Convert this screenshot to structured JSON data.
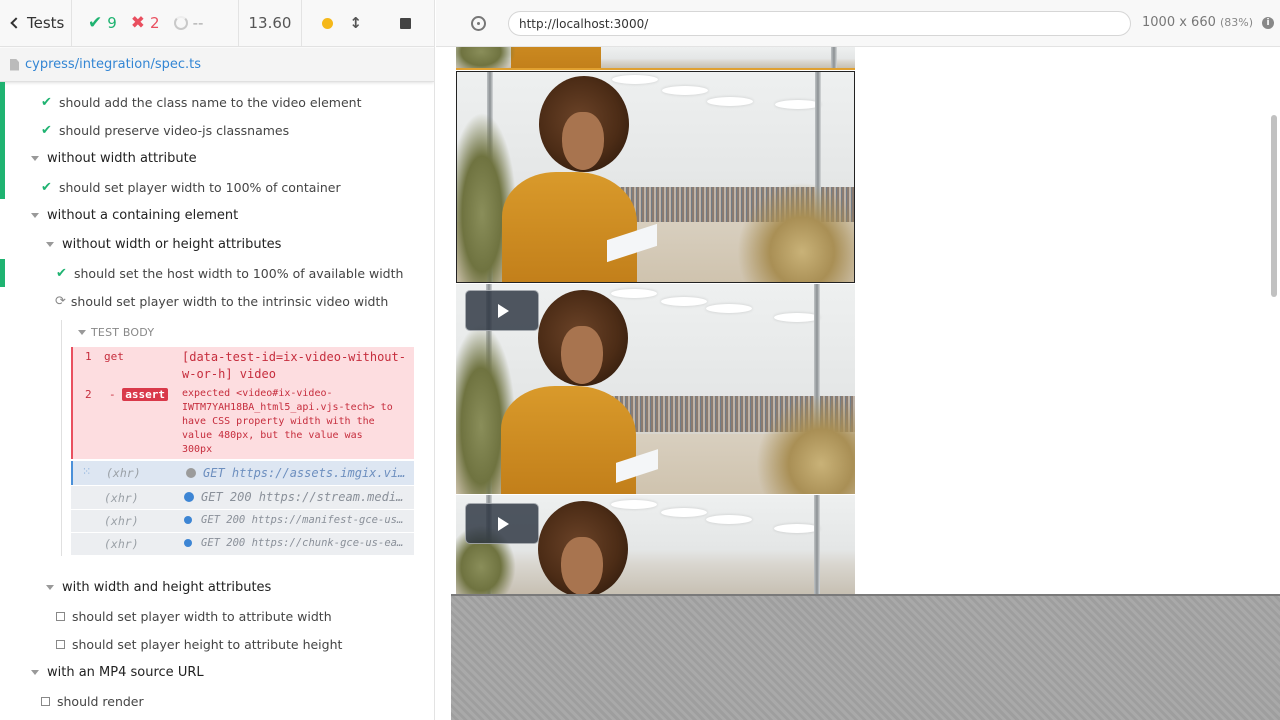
{
  "stats": {
    "tests_label": "Tests",
    "passed": "9",
    "failed": "2",
    "pending": "--",
    "duration": "13.60"
  },
  "spec": {
    "path": "cypress/integration/spec.ts"
  },
  "tree": {
    "t1": "should add the class name to the video element",
    "t2": "should preserve video-js classnames",
    "s1": "without width attribute",
    "t3": "should set player width to 100% of container",
    "s2": "without a containing element",
    "s3": "without width or height attributes",
    "t4": "should set the host width to 100% of available width",
    "t5": "should set player width to the intrinsic video width",
    "test_body": "TEST BODY",
    "s4": "with width and height attributes",
    "t6": "should set player width to attribute width",
    "t7": "should set player height to attribute height",
    "s5": "with an MP4 source URL",
    "t8": "should render"
  },
  "commands": {
    "c1_num": "1",
    "c1_name": "get",
    "c1_msg_a": "[data-test-id=ix-video-without-",
    "c1_msg_b": "w-or-h] video",
    "c2_num": "2",
    "c2_prefix": "-",
    "c2_name": "assert",
    "c2_msg_1": "expected <video#ix-video-",
    "c2_msg_2": "IWTM7YAH18BA_html5_api.vjs-tech> to",
    "c2_msg_3": "have CSS property width with the",
    "c2_msg_4": "value 480px, but the value was",
    "c2_msg_5": "300px",
    "xhr_label": "(xhr)",
    "x1": "GET https://assets.imgix.vi…",
    "x2": "GET 200 https://stream.medi…",
    "x3": "GET 200 https://manifest-gce-us-e…",
    "x4": "GET 200 https://chunk-gce-us-east…"
  },
  "aut": {
    "url": "http://localhost:3000/",
    "viewport": "1000 x 660",
    "scale": "(83%)",
    "info": "i"
  },
  "colors": {
    "pass": "#1fb371",
    "fail": "#e94f5f",
    "running": "#f5b81a",
    "xhr_pending": "#999999",
    "xhr_done": "#3d85d4"
  },
  "icons": [
    "chevron-left-icon",
    "check-icon",
    "x-icon",
    "pending-circle-icon",
    "running-dot-icon",
    "resize-arrows-icon",
    "stop-icon",
    "file-icon",
    "crosshair-icon",
    "info-icon",
    "play-icon"
  ]
}
